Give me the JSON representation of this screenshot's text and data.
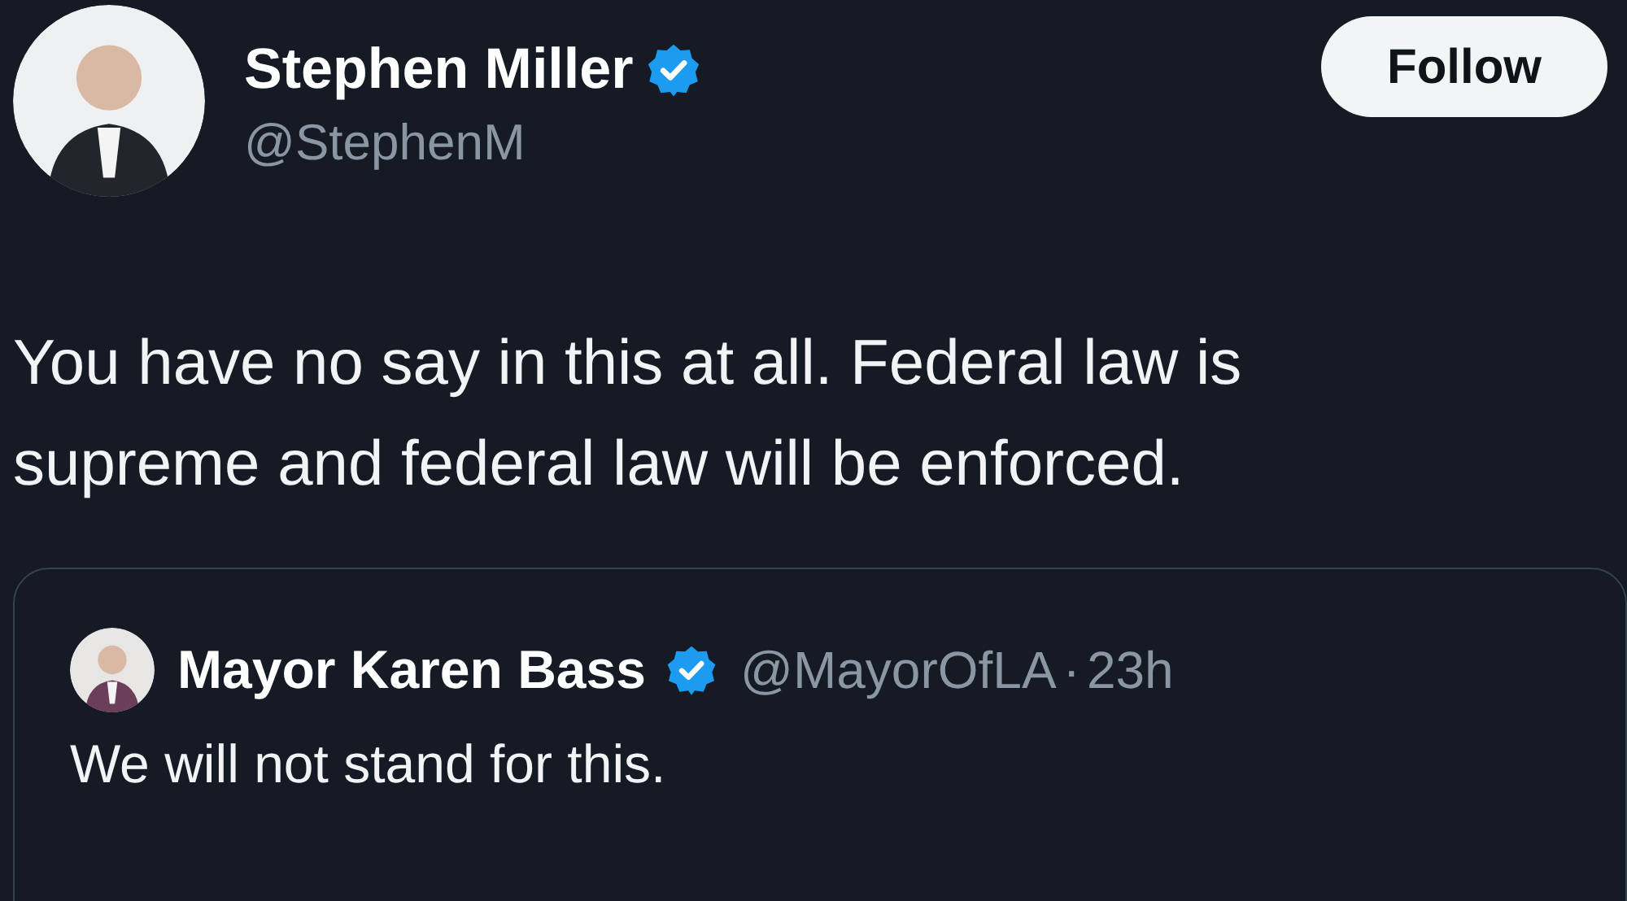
{
  "author": {
    "name": "Stephen Miller",
    "verified": true,
    "handle": "@StephenM"
  },
  "follow_button": {
    "label": "Follow"
  },
  "text": "You have no say in this at all. Federal law is supreme and federal law will be enforced.",
  "quoted": {
    "name": "Mayor Karen Bass",
    "verified": true,
    "handle": "@MayorOfLA",
    "separator": "·",
    "time": "23h",
    "text": "We will not stand for this."
  }
}
